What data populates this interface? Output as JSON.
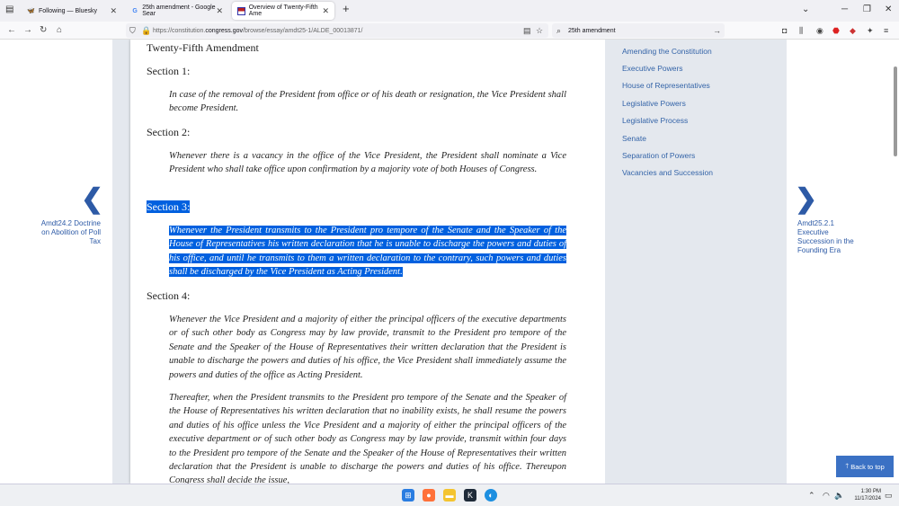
{
  "tabs": [
    {
      "title": "Following — Bluesky",
      "icon": "butterfly-icon"
    },
    {
      "title": "25th amendment - Google Sear",
      "icon": "google-icon"
    },
    {
      "title": "Overview of Twenty-Fifth Ame",
      "icon": "flag-icon"
    }
  ],
  "url": {
    "prefix": "https://constitution.",
    "domain": "congress.gov",
    "path": "/browse/essay/amdt25-1/ALDE_00013871/"
  },
  "search_text": "25th amendment",
  "doc": {
    "title": "Twenty-Fifth Amendment",
    "sections": [
      {
        "heading": "Section 1:",
        "paras": [
          "In case of the removal of the President from office or of his death or resignation, the Vice President shall become President."
        ]
      },
      {
        "heading": "Section 2:",
        "paras": [
          "Whenever there is a vacancy in the office of the Vice President, the President shall nominate a Vice President who shall take office upon confirmation by a majority vote of both Houses of Congress."
        ]
      },
      {
        "heading": "Section 3:",
        "paras": [
          "Whenever the President transmits to the President pro tempore of the Senate and the Speaker of the House of Representatives his written declaration that he is unable to discharge the powers and duties of his office, and until he transmits to them a written declaration to the contrary, such powers and duties shall be discharged by the Vice President as Acting President."
        ]
      },
      {
        "heading": "Section 4:",
        "paras": [
          "Whenever the Vice President and a majority of either the principal officers of the executive departments or of such other body as Congress may by law provide, transmit to the President pro tempore of the Senate and the Speaker of the House of Representatives their written declaration that the President is unable to discharge the powers and duties of his office, the Vice President shall immediately assume the powers and duties of the office as Acting President.",
          "Thereafter, when the President transmits to the President pro tempore of the Senate and the Speaker of the House of Representatives his written declaration that no inability exists, he shall resume the powers and duties of his office unless the Vice President and a majority of either the principal officers of the executive department or of such other body as Congress may by law provide, transmit within four days to the President pro tempore of the Senate and the Speaker of the House of Representatives their written declaration that the President is unable to discharge the powers and duties of his office. Thereupon Congress shall decide the issue,"
        ]
      }
    ]
  },
  "sidebar_links": [
    "Amending the Constitution",
    "Executive Powers",
    "House of Representatives",
    "Legislative Powers",
    "Legislative Process",
    "Senate",
    "Separation of Powers",
    "Vacancies and Succession"
  ],
  "prev": {
    "label": "Amdt24.2 Doctrine on Abolition of Poll Tax"
  },
  "next": {
    "label": "Amdt25.2.1 Executive Succession in the Founding Era"
  },
  "back_to_top": "Back to top",
  "clock": {
    "time": "1:30 PM",
    "date": "11/17/2024"
  },
  "colors": {
    "link": "#3464a8",
    "selection": "#0060df",
    "back_to_top": "#3b71c4"
  }
}
